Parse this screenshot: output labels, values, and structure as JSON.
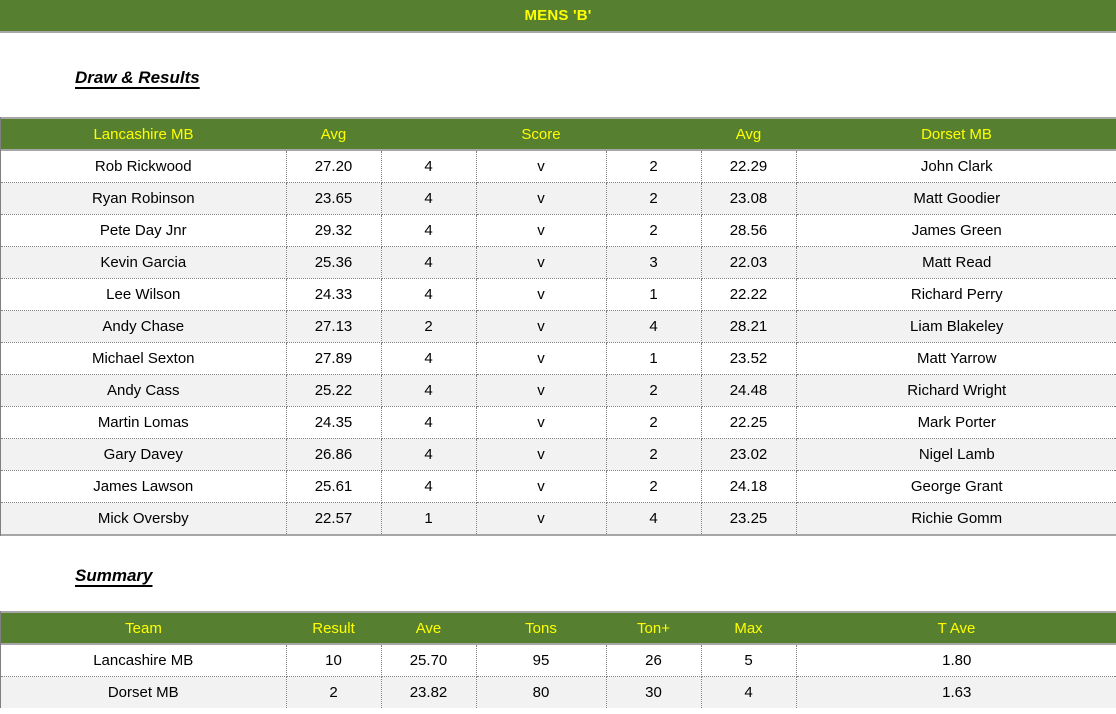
{
  "banner": {
    "title": "MENS 'B'"
  },
  "sections": {
    "draw_results_heading": "Draw & Results",
    "summary_heading": "Summary"
  },
  "colors": {
    "header_green": "#56802f",
    "header_text_yellow": "#ffff00",
    "row_stripe": "#f2f2f2",
    "body_text": "#000000",
    "grid_line": "#808080",
    "table_edge": "#a6a6a6"
  },
  "results_table": {
    "headers": {
      "home_team": "Lancashire MB",
      "home_avg": "Avg",
      "home_score": "",
      "score": "Score",
      "away_score": "",
      "away_avg": "Avg",
      "away_team": "Dorset MB"
    },
    "rows": [
      {
        "home_player": "Rob Rickwood",
        "home_avg": "27.20",
        "home_score": "4",
        "vs": "v",
        "away_score": "2",
        "away_avg": "22.29",
        "away_player": "John Clark"
      },
      {
        "home_player": "Ryan Robinson",
        "home_avg": "23.65",
        "home_score": "4",
        "vs": "v",
        "away_score": "2",
        "away_avg": "23.08",
        "away_player": "Matt Goodier"
      },
      {
        "home_player": "Pete Day Jnr",
        "home_avg": "29.32",
        "home_score": "4",
        "vs": "v",
        "away_score": "2",
        "away_avg": "28.56",
        "away_player": "James Green"
      },
      {
        "home_player": "Kevin Garcia",
        "home_avg": "25.36",
        "home_score": "4",
        "vs": "v",
        "away_score": "3",
        "away_avg": "22.03",
        "away_player": "Matt Read"
      },
      {
        "home_player": "Lee Wilson",
        "home_avg": "24.33",
        "home_score": "4",
        "vs": "v",
        "away_score": "1",
        "away_avg": "22.22",
        "away_player": "Richard Perry"
      },
      {
        "home_player": "Andy Chase",
        "home_avg": "27.13",
        "home_score": "2",
        "vs": "v",
        "away_score": "4",
        "away_avg": "28.21",
        "away_player": "Liam Blakeley"
      },
      {
        "home_player": "Michael Sexton",
        "home_avg": "27.89",
        "home_score": "4",
        "vs": "v",
        "away_score": "1",
        "away_avg": "23.52",
        "away_player": "Matt Yarrow"
      },
      {
        "home_player": "Andy Cass",
        "home_avg": "25.22",
        "home_score": "4",
        "vs": "v",
        "away_score": "2",
        "away_avg": "24.48",
        "away_player": "Richard Wright"
      },
      {
        "home_player": "Martin Lomas",
        "home_avg": "24.35",
        "home_score": "4",
        "vs": "v",
        "away_score": "2",
        "away_avg": "22.25",
        "away_player": "Mark Porter"
      },
      {
        "home_player": "Gary Davey",
        "home_avg": "26.86",
        "home_score": "4",
        "vs": "v",
        "away_score": "2",
        "away_avg": "23.02",
        "away_player": "Nigel Lamb"
      },
      {
        "home_player": "James Lawson",
        "home_avg": "25.61",
        "home_score": "4",
        "vs": "v",
        "away_score": "2",
        "away_avg": "24.18",
        "away_player": "George Grant"
      },
      {
        "home_player": "Mick Oversby",
        "home_avg": "22.57",
        "home_score": "1",
        "vs": "v",
        "away_score": "4",
        "away_avg": "23.25",
        "away_player": "Richie Gomm"
      }
    ]
  },
  "summary_table": {
    "headers": {
      "team": "Team",
      "result": "Result",
      "ave": "Ave",
      "tons": "Tons",
      "ton_plus": "Ton+",
      "max": "Max",
      "t_ave": "T Ave"
    },
    "rows": [
      {
        "team": "Lancashire MB",
        "result": "10",
        "ave": "25.70",
        "tons": "95",
        "ton_plus": "26",
        "max": "5",
        "t_ave": "1.80"
      },
      {
        "team": "Dorset MB",
        "result": "2",
        "ave": "23.82",
        "tons": "80",
        "ton_plus": "30",
        "max": "4",
        "t_ave": "1.63"
      }
    ]
  }
}
